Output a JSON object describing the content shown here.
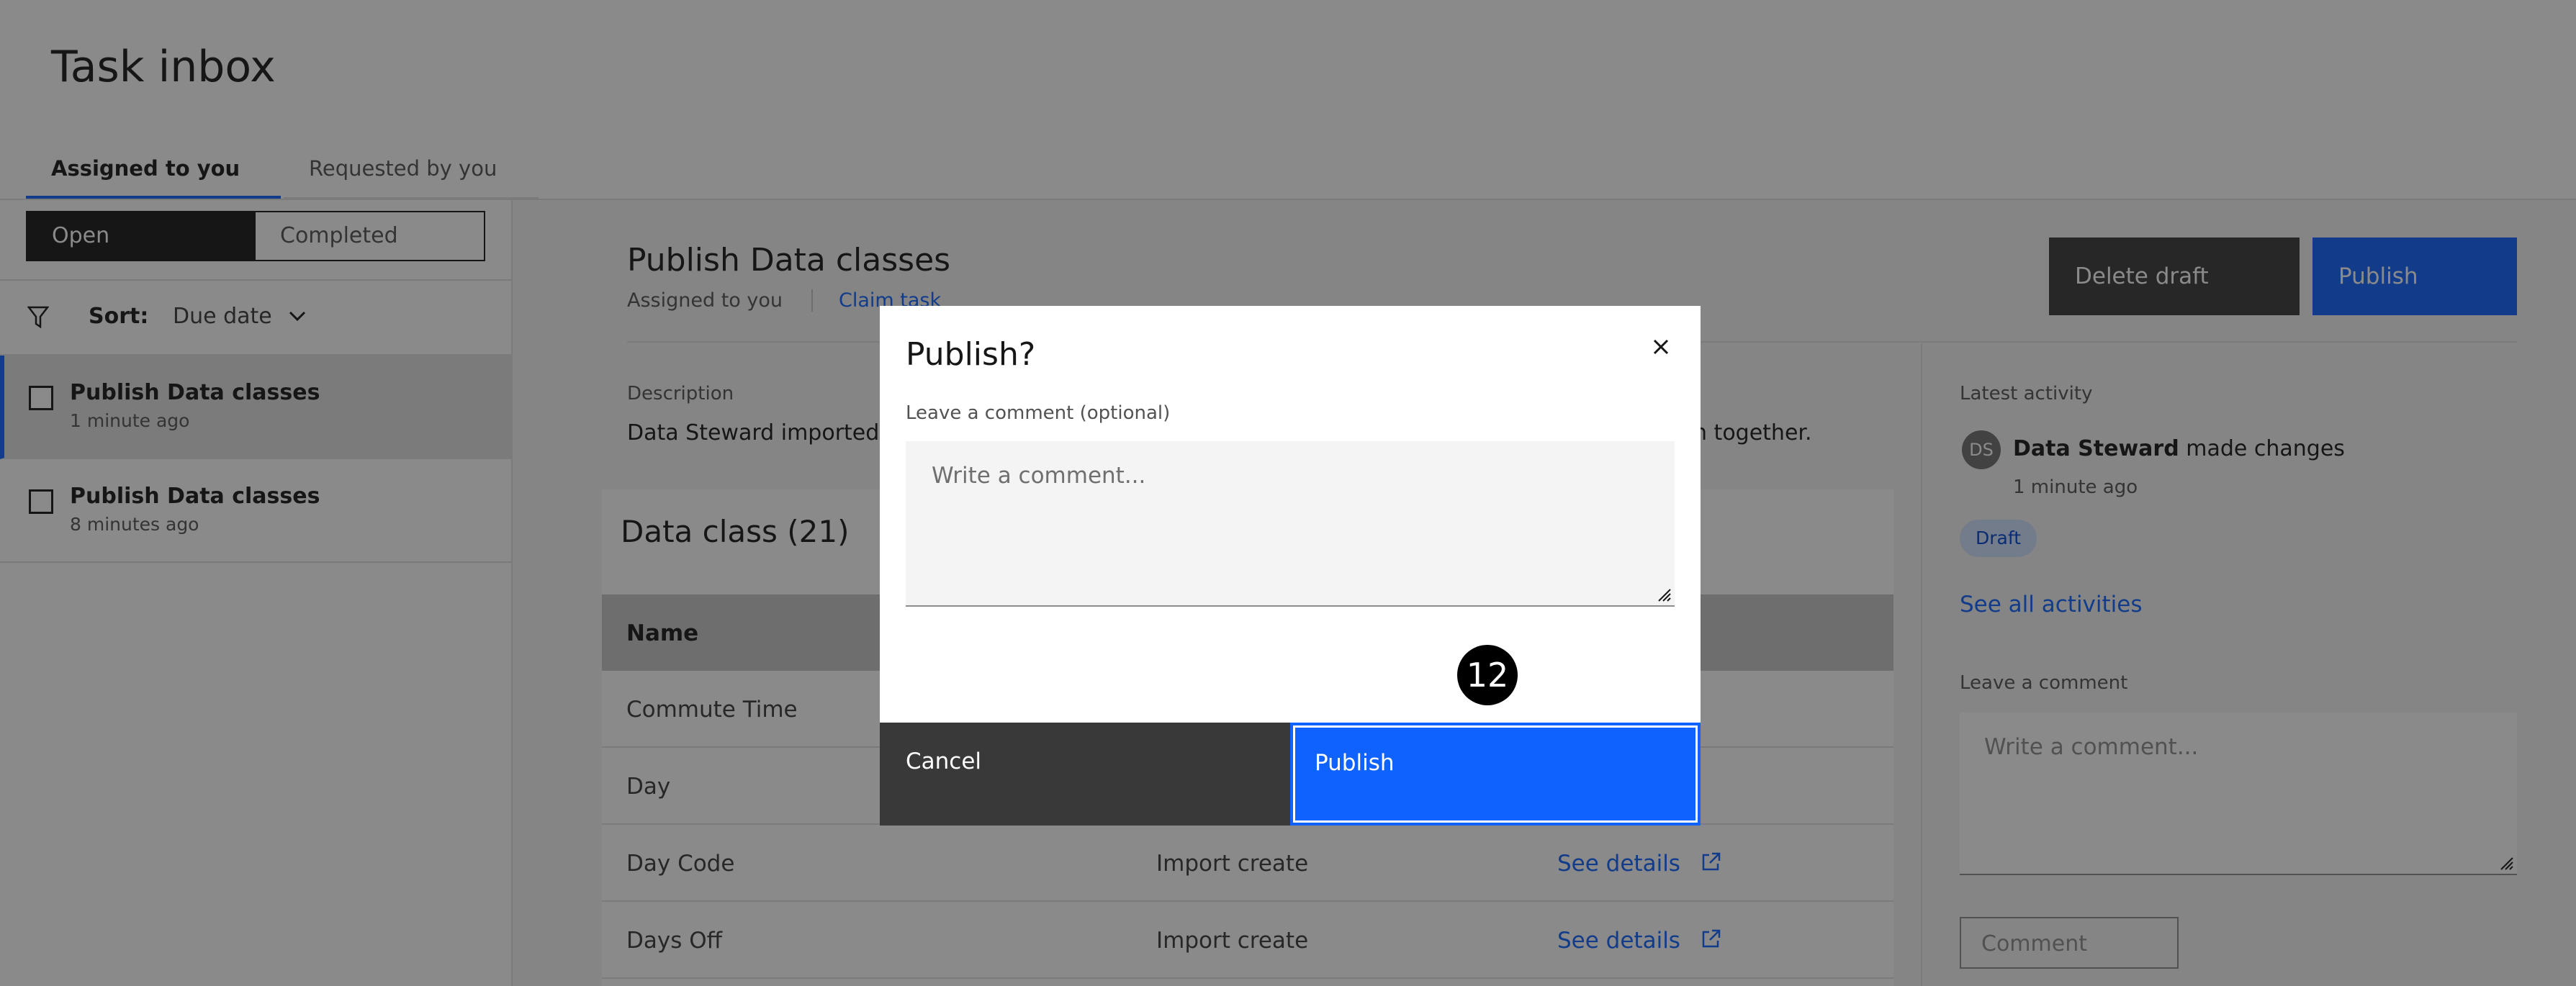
{
  "page": {
    "title": "Task inbox",
    "tabs": [
      {
        "label": "Assigned to you",
        "active": true
      },
      {
        "label": "Requested by you",
        "active": false
      }
    ]
  },
  "left": {
    "toggle": {
      "open": "Open",
      "completed": "Completed"
    },
    "sort_label": "Sort:",
    "sort_value": "Due date",
    "tasks": [
      {
        "title": "Publish Data classes",
        "time": "1 minute ago"
      },
      {
        "title": "Publish Data classes",
        "time": "8 minutes ago"
      }
    ]
  },
  "main": {
    "title": "Publish Data classes",
    "assigned": "Assigned to you",
    "claim": "Claim task",
    "delete_label": "Delete draft",
    "publish_label": "Publish",
    "description_label": "Description",
    "description_start": "Data Steward imported t",
    "description_end": "n together.",
    "table": {
      "title": "Data class (21)",
      "header_name": "Name",
      "rows": [
        {
          "name": "Commute Time",
          "action": "",
          "link": ""
        },
        {
          "name": "Day",
          "action": "",
          "link": ""
        },
        {
          "name": "Day Code",
          "action": "Import create",
          "link": "See details"
        },
        {
          "name": "Days Off",
          "action": "Import create",
          "link": "See details"
        }
      ]
    }
  },
  "activity": {
    "label": "Latest activity",
    "avatar": "DS",
    "user": "Data Steward",
    "action": " made changes",
    "time": "1 minute ago",
    "tag": "Draft",
    "see_all": "See all activities",
    "comment_label": "Leave a comment",
    "comment_placeholder": "Write a comment...",
    "comment_button": "Comment"
  },
  "modal": {
    "title": "Publish?",
    "label": "Leave a comment (optional)",
    "placeholder": "Write a comment...",
    "cancel": "Cancel",
    "publish": "Publish",
    "step": "12"
  }
}
